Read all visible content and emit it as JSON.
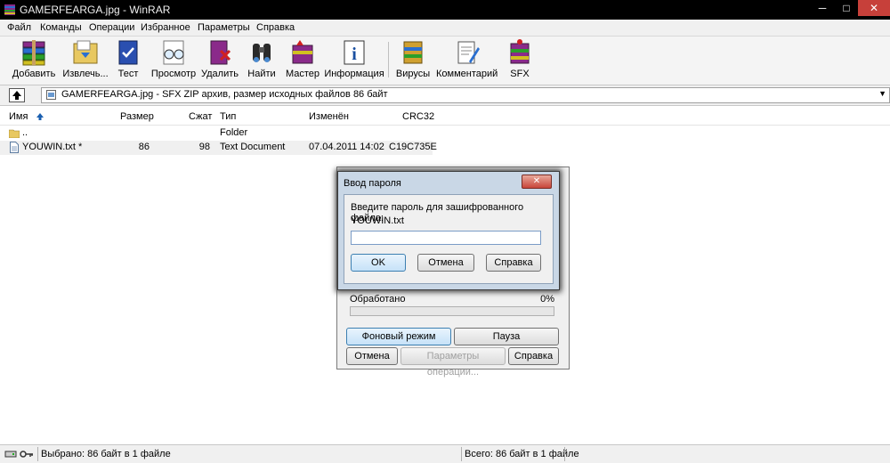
{
  "window": {
    "title": "GAMERFEARGA.jpg - WinRAR",
    "minimize": "─",
    "maximize": "□",
    "close": "✕"
  },
  "menu": [
    "Файл",
    "Команды",
    "Операции",
    "Избранное",
    "Параметры",
    "Справка"
  ],
  "toolbar": {
    "add": "Добавить",
    "extract": "Извлечь...",
    "test": "Тест",
    "view": "Просмотр",
    "delete": "Удалить",
    "find": "Найти",
    "wizard": "Мастер",
    "info": "Информация",
    "virus": "Вирусы",
    "comment": "Комментарий",
    "sfx": "SFX"
  },
  "address": {
    "text": "GAMERFEARGA.jpg - SFX ZIP архив, размер исходных файлов 86 байт",
    "dropdown_icon": "▼"
  },
  "columns": {
    "name": "Имя",
    "size": "Размер",
    "packed": "Сжат",
    "type": "Тип",
    "modified": "Изменён",
    "crc": "CRC32"
  },
  "rows": [
    {
      "name": "..",
      "size": "",
      "packed": "",
      "type": "Folder",
      "modified": "",
      "crc": ""
    },
    {
      "name": "YOUWIN.txt *",
      "size": "86",
      "packed": "98",
      "type": "Text Document",
      "modified": "07.04.2011 14:02",
      "crc": "C19C735E"
    }
  ],
  "progress": {
    "processed_label": "Обработано",
    "percent": "0%",
    "fraction": 0,
    "background_btn": "Фоновый режим",
    "pause_btn": "Пауза",
    "cancel_btn": "Отмена",
    "options_btn": "Параметры операции...",
    "help_btn": "Справка"
  },
  "password_dialog": {
    "title": "Ввод пароля",
    "close": "✕",
    "prompt": "Введите пароль для зашифрованного файла:",
    "filename": "YOUWIN.txt",
    "password_value": "",
    "ok": "OK",
    "cancel": "Отмена",
    "help": "Справка"
  },
  "status": {
    "selected": "Выбрано: 86 байт в 1 файле",
    "total": "Всего: 86 байт в 1 файле"
  },
  "colors": {
    "title_bg": "#000000",
    "close_red": "#c7403a",
    "dialog_frame": "#c9d7e6",
    "focus_blue": "#3c7fb1"
  }
}
